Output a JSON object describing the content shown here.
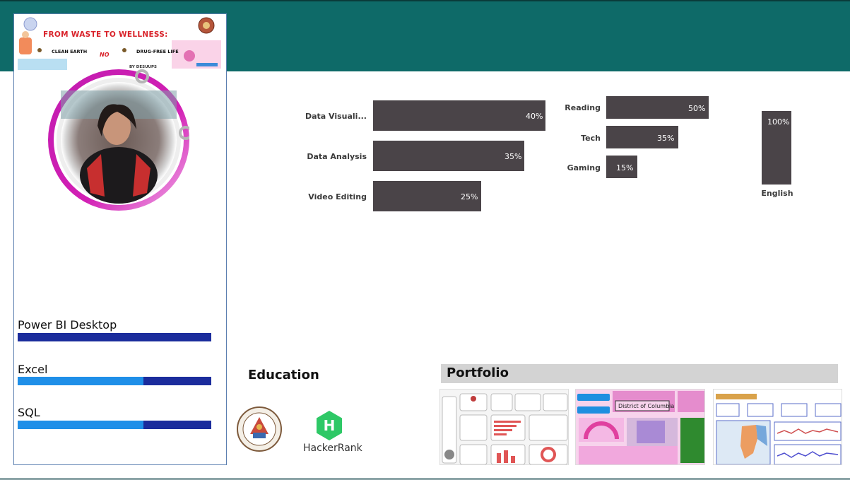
{
  "banner": {
    "title": "FROM WASTE TO WELLNESS:",
    "left_tag": "CLEAN EARTH",
    "right_tag": "DRUG-FREE LIFE",
    "no_text": "NO",
    "by_text": "BY DESUUPS"
  },
  "skills": [
    {
      "label": "Power BI Desktop",
      "level": 0.0
    },
    {
      "label": "Excel",
      "level": 0.65
    },
    {
      "label": "SQL",
      "level": 0.65
    }
  ],
  "skills_chart": {
    "categories": [
      "Data Visuali...",
      "Data Analysis",
      "Video Editing"
    ],
    "values": [
      40,
      35,
      25
    ],
    "value_labels": [
      "40%",
      "35%",
      "25%"
    ]
  },
  "hobbies_chart": {
    "categories": [
      "Reading",
      "Tech",
      "Gaming"
    ],
    "values": [
      50,
      35,
      15
    ],
    "value_labels": [
      "50%",
      "35%",
      "15%"
    ]
  },
  "language_chart": {
    "categories": [
      "English"
    ],
    "values": [
      100
    ],
    "value_labels": [
      "100%"
    ]
  },
  "education": {
    "title": "Education",
    "hackerrank_label": "HackerRank",
    "hackerrank_letter": "H"
  },
  "portfolio": {
    "title": "Portfolio",
    "thumb2_label": "District of Columbia",
    "colors": {
      "brand": "#0e6a68",
      "bar": "#4a4448",
      "skill_dark": "#1b2c9c",
      "skill_light": "#1f8fe8",
      "ring": "#d21fb4",
      "hackerrank": "#2ec866"
    }
  }
}
